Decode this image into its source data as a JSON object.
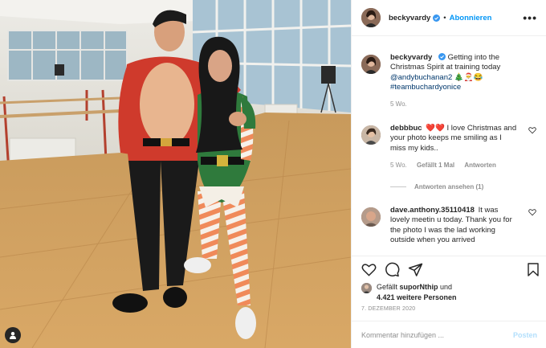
{
  "header": {
    "username": "beckyvardy",
    "separator": "•",
    "follow_label": "Abonnieren",
    "more_label": "•••"
  },
  "caption": {
    "username": "beckyvardy",
    "text": "Getting into the Christmas Spirit at training today",
    "mention": "@andybuchanan2",
    "emojis": "🎄🎅😂",
    "hashtag": "#teambuchardyonice",
    "age": "5 Wo."
  },
  "comments": [
    {
      "username": "debbbuc",
      "text": "❤️❤️ I love Christmas and your photo keeps me smiling as I miss my kids..",
      "age": "5 Wo.",
      "likes": "Gefällt 1 Mal",
      "reply_label": "Antworten",
      "view_replies": "Antworten ansehen (1)"
    },
    {
      "username": "dave.anthony.35110418",
      "text": "It was lovely meetin u today. Thank you for the photo I was the lad working outside when you arrived"
    }
  ],
  "likes": {
    "prefix": "Gefällt",
    "user": "suporNthip",
    "connector": "und",
    "others": "4.421 weitere Personen"
  },
  "date": "7. DEZEMBER 2020",
  "comment_input": {
    "placeholder": "Kommentar hinzufügen ...",
    "post_label": "Posten"
  },
  "colors": {
    "accent": "#0095f6",
    "link": "#00376b",
    "muted": "#8e8e8e",
    "heart": "#ed4956",
    "post_disabled": "#b2dffc"
  }
}
